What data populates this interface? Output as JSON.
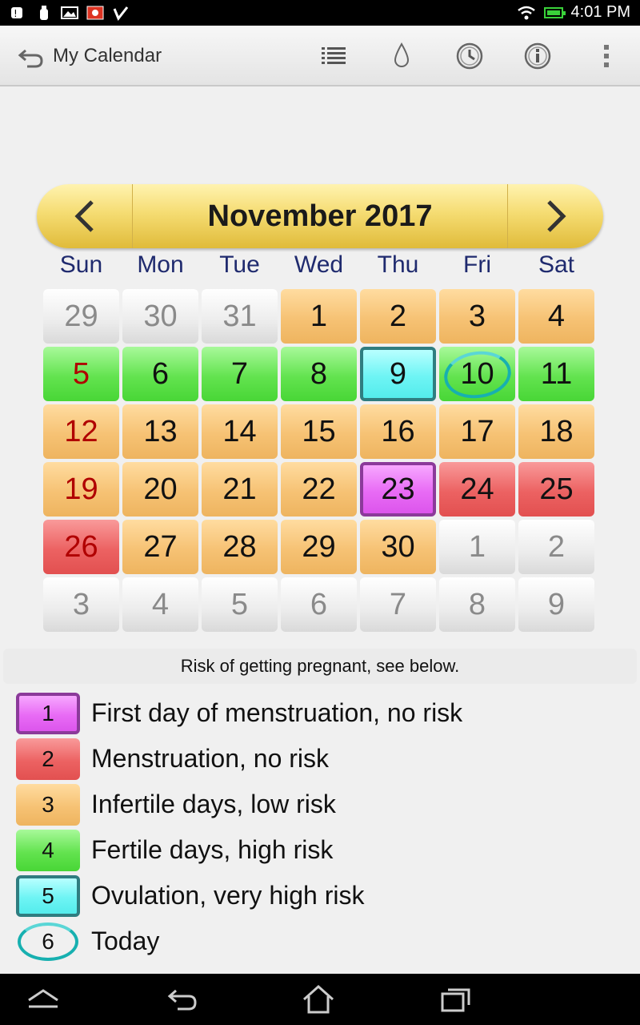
{
  "status_bar": {
    "time": "4:01 PM"
  },
  "action_bar": {
    "title": "My Calendar",
    "icons": [
      "back-icon",
      "list-icon",
      "drop-icon",
      "clock-icon",
      "info-icon",
      "overflow-menu-icon"
    ]
  },
  "calendar": {
    "month_title": "November 2017",
    "weekdays": [
      "Sun",
      "Mon",
      "Tue",
      "Wed",
      "Thu",
      "Fri",
      "Sat"
    ],
    "weeks": [
      [
        {
          "d": "29",
          "t": "other"
        },
        {
          "d": "30",
          "t": "other"
        },
        {
          "d": "31",
          "t": "other"
        },
        {
          "d": "1",
          "t": "infertile"
        },
        {
          "d": "2",
          "t": "infertile"
        },
        {
          "d": "3",
          "t": "infertile"
        },
        {
          "d": "4",
          "t": "infertile"
        }
      ],
      [
        {
          "d": "5",
          "t": "fertile",
          "red": true
        },
        {
          "d": "6",
          "t": "fertile"
        },
        {
          "d": "7",
          "t": "fertile"
        },
        {
          "d": "8",
          "t": "fertile"
        },
        {
          "d": "9",
          "t": "ovul"
        },
        {
          "d": "10",
          "t": "fertile",
          "today": true
        },
        {
          "d": "11",
          "t": "fertile"
        }
      ],
      [
        {
          "d": "12",
          "t": "infertile",
          "red": true
        },
        {
          "d": "13",
          "t": "infertile"
        },
        {
          "d": "14",
          "t": "infertile"
        },
        {
          "d": "15",
          "t": "infertile"
        },
        {
          "d": "16",
          "t": "infertile"
        },
        {
          "d": "17",
          "t": "infertile"
        },
        {
          "d": "18",
          "t": "infertile"
        }
      ],
      [
        {
          "d": "19",
          "t": "infertile",
          "red": true
        },
        {
          "d": "20",
          "t": "infertile"
        },
        {
          "d": "21",
          "t": "infertile"
        },
        {
          "d": "22",
          "t": "infertile"
        },
        {
          "d": "23",
          "t": "first"
        },
        {
          "d": "24",
          "t": "menstr"
        },
        {
          "d": "25",
          "t": "menstr"
        }
      ],
      [
        {
          "d": "26",
          "t": "menstr",
          "red": true
        },
        {
          "d": "27",
          "t": "infertile"
        },
        {
          "d": "28",
          "t": "infertile"
        },
        {
          "d": "29",
          "t": "infertile"
        },
        {
          "d": "30",
          "t": "infertile"
        },
        {
          "d": "1",
          "t": "other"
        },
        {
          "d": "2",
          "t": "other"
        }
      ],
      [
        {
          "d": "3",
          "t": "other"
        },
        {
          "d": "4",
          "t": "other"
        },
        {
          "d": "5",
          "t": "other"
        },
        {
          "d": "6",
          "t": "other"
        },
        {
          "d": "7",
          "t": "other"
        },
        {
          "d": "8",
          "t": "other"
        },
        {
          "d": "9",
          "t": "other"
        }
      ]
    ]
  },
  "legend": {
    "note": "Risk of getting pregnant, see below.",
    "items": [
      {
        "num": "1",
        "label": "First day of menstruation, no risk",
        "t": "first"
      },
      {
        "num": "2",
        "label": "Menstruation, no risk",
        "t": "menstr"
      },
      {
        "num": "3",
        "label": "Infertile days, low risk",
        "t": "infertile"
      },
      {
        "num": "4",
        "label": "Fertile days, high risk",
        "t": "fertile"
      },
      {
        "num": "5",
        "label": "Ovulation, very high risk",
        "t": "ovul"
      },
      {
        "num": "6",
        "label": "Today",
        "t": "today"
      }
    ]
  },
  "colors": {
    "first_day": "#dc55ec",
    "menstruation": "#e25050",
    "infertile": "#f6c274",
    "fertile": "#63e34f",
    "ovulation": "#6ef4f4",
    "today_ring": "#17b0b0"
  }
}
